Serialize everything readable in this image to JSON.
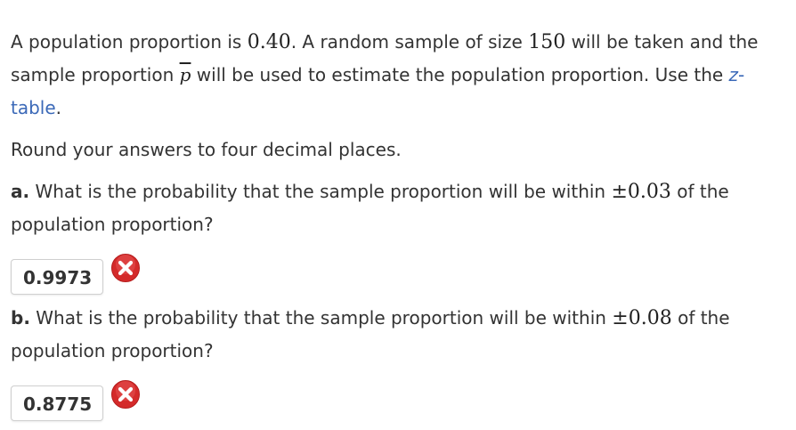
{
  "intro": {
    "t1": "A population proportion is ",
    "p_value": "0.40",
    "t2": ". A random sample of size ",
    "n_value": "150",
    "t3": " will be taken and the",
    "t4": "sample proportion ",
    "pbar_symbol": "p",
    "t5": " will be used to estimate the population proportion. Use the ",
    "link_z": "z",
    "link_dash": "-",
    "link_table": "table",
    "t6": "."
  },
  "instruction": "Round your answers to four decimal places.",
  "questions": [
    {
      "label": "a.",
      "t1": " What is the probability that the sample proportion will be within ",
      "value": "±0.03",
      "t2": " of the",
      "t3": "population proportion?",
      "answer": "0.9973",
      "status_icon": "incorrect-x-icon"
    },
    {
      "label": "b.",
      "t1": " What is the probability that the sample proportion will be within ",
      "value": "±0.08",
      "t2": " of the",
      "t3": "population proportion?",
      "answer": "0.8775",
      "status_icon": "incorrect-x-icon"
    }
  ],
  "colors": {
    "link": "#3b69b8",
    "incorrect": "#d42a2a"
  }
}
